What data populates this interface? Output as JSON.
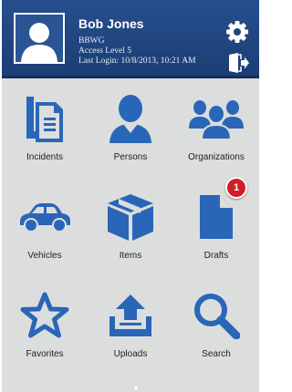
{
  "user": {
    "name": "Bob Jones",
    "org": "BBWG",
    "access": "Access Level 5",
    "last_login": "Last Login: 10/8/2013, 10:21 AM"
  },
  "header_icons": {
    "settings": "gear-icon",
    "logout": "logout-icon"
  },
  "colors": {
    "accent": "#2a66b8",
    "header": "#1f467f",
    "background": "#dcdedd",
    "badge": "#cf2027"
  },
  "tiles": [
    {
      "label": "Incidents",
      "icon": "documents-icon"
    },
    {
      "label": "Persons",
      "icon": "person-icon"
    },
    {
      "label": "Organizations",
      "icon": "group-icon"
    },
    {
      "label": "Vehicles",
      "icon": "car-icon"
    },
    {
      "label": "Items",
      "icon": "box-icon"
    },
    {
      "label": "Drafts",
      "icon": "draft-document-icon",
      "badge": "1"
    },
    {
      "label": "Favorites",
      "icon": "star-icon"
    },
    {
      "label": "Uploads",
      "icon": "upload-icon"
    },
    {
      "label": "Search",
      "icon": "search-icon"
    }
  ]
}
